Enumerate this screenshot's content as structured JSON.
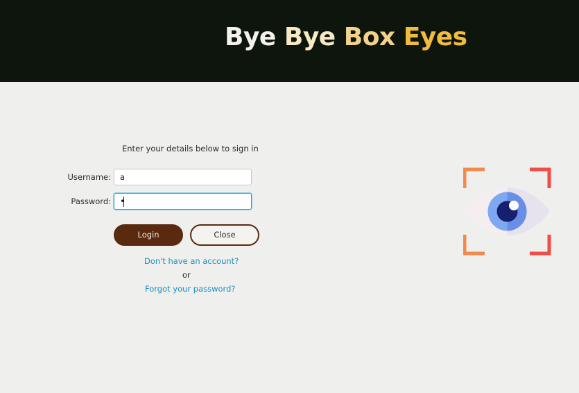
{
  "header": {
    "title_parts": [
      "Bye",
      "Bye",
      "Box",
      "Eyes"
    ],
    "background": "#0d150d"
  },
  "form": {
    "instruction": "Enter your details below to sign in",
    "username_label": "Username:",
    "username_value": "a",
    "password_label": "Password:",
    "password_masked": "•",
    "login_label": "Login",
    "close_label": "Close",
    "signup_link": "Don't have an account?",
    "or_text": "or",
    "forgot_link": "Forgot your password?"
  },
  "colors": {
    "accent_brown": "#5a2a10",
    "link_blue": "#1c8fc0",
    "focus_blue": "#2ea3d9",
    "title_gold": "#f1bc3e"
  },
  "logo": {
    "icon": "eye-focus-icon"
  }
}
